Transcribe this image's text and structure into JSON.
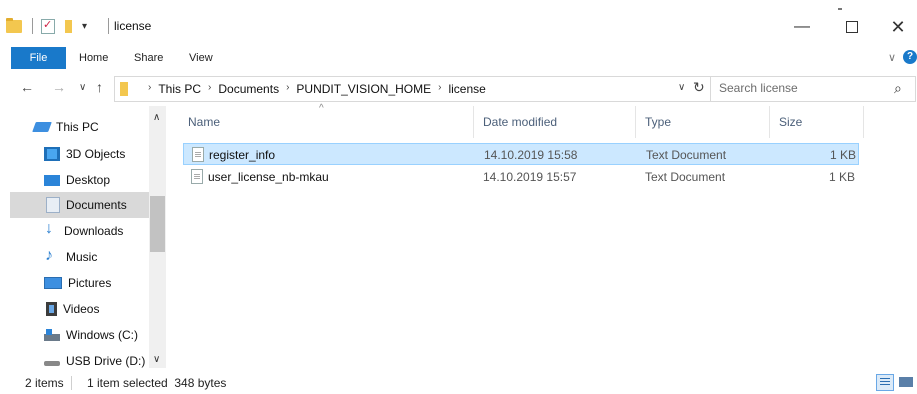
{
  "window": {
    "title": "license",
    "controls": {
      "minimize": "—",
      "maximize": "",
      "close": "✕"
    }
  },
  "ribbon": {
    "tabs": [
      {
        "label": "File",
        "active": true
      },
      {
        "label": "Home"
      },
      {
        "label": "Share"
      },
      {
        "label": "View"
      }
    ],
    "expand_icon": "chevron-down-icon",
    "help": "?"
  },
  "address": {
    "crumbs": [
      "This PC",
      "Documents",
      "PUNDIT_VISION_HOME",
      "license"
    ]
  },
  "search": {
    "placeholder": "Search license"
  },
  "navpane": {
    "items": [
      {
        "label": "This PC",
        "icon": "computer-icon"
      },
      {
        "label": "3D Objects",
        "icon": "3d-objects-icon"
      },
      {
        "label": "Desktop",
        "icon": "desktop-icon"
      },
      {
        "label": "Documents",
        "icon": "documents-icon",
        "selected": true
      },
      {
        "label": "Downloads",
        "icon": "downloads-icon"
      },
      {
        "label": "Music",
        "icon": "music-icon"
      },
      {
        "label": "Pictures",
        "icon": "pictures-icon"
      },
      {
        "label": "Videos",
        "icon": "videos-icon"
      },
      {
        "label": "Windows (C:)",
        "icon": "drive-icon"
      },
      {
        "label": "USB Drive (D:)",
        "icon": "usb-drive-icon"
      }
    ]
  },
  "filelist": {
    "columns": [
      "Name",
      "Date modified",
      "Type",
      "Size"
    ],
    "rows": [
      {
        "name": "register_info",
        "date": "14.10.2019 15:58",
        "type": "Text Document",
        "size": "1 KB",
        "selected": true
      },
      {
        "name": "user_license_nb-mkau",
        "date": "14.10.2019 15:57",
        "type": "Text Document",
        "size": "1 KB"
      }
    ]
  },
  "status": {
    "items": "2 items",
    "selected": "1 item selected  348 bytes"
  }
}
